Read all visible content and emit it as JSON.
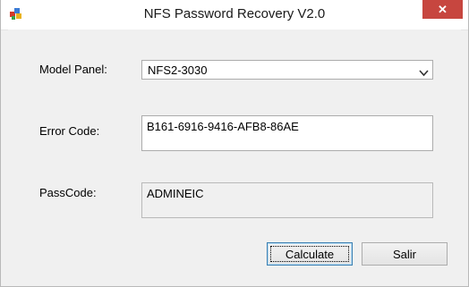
{
  "window": {
    "title": "NFS Password Recovery V2.0",
    "close_glyph": "✕"
  },
  "icons": {
    "app": "app-icon",
    "close": "close-icon",
    "dropdown": "chevron-down-icon"
  },
  "form": {
    "model_label": "Model Panel:",
    "model_value": "NFS2-3030",
    "error_label": "Error Code:",
    "error_value": "B161-6916-9416-AFB8-86AE",
    "pass_label": "PassCode:",
    "pass_value": "ADMINEIC"
  },
  "buttons": {
    "calculate": "Calculate",
    "exit": "Salir"
  },
  "colors": {
    "close_button": "#c7463f",
    "focus_border": "#3c7fb1"
  }
}
